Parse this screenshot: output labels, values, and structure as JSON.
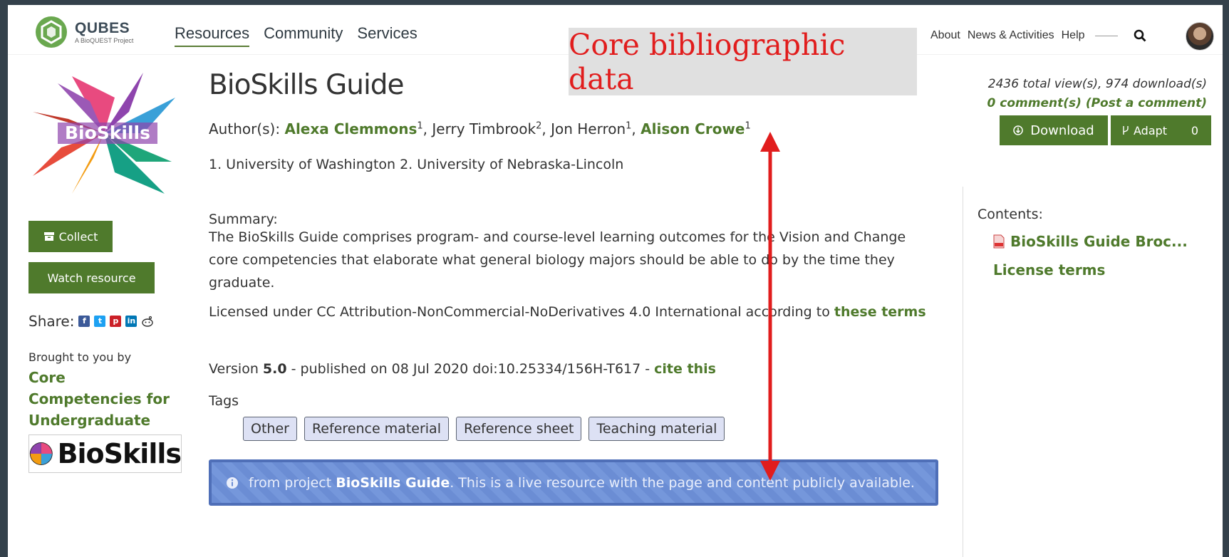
{
  "header": {
    "brand_name": "QUBES",
    "brand_sub": "A BioQUEST Project",
    "nav": [
      "Resources",
      "Community",
      "Services"
    ],
    "right_nav": [
      "About",
      "News & Activities",
      "Help"
    ]
  },
  "annotation": {
    "label": "Core bibliographic data",
    "color": "#e11d1d"
  },
  "resource": {
    "title": "BioSkills Guide",
    "authors_label": "Author(s):",
    "authors": [
      {
        "name": "Alexa Clemmons",
        "sup": "1",
        "linked": true
      },
      {
        "name": "Jerry Timbrook",
        "sup": "2",
        "linked": false
      },
      {
        "name": "Jon Herron",
        "sup": "1",
        "linked": false
      },
      {
        "name": "Alison Crowe",
        "sup": "1",
        "linked": true
      }
    ],
    "affiliations": "1. University of Washington 2. University of Nebraska-Lincoln",
    "summary_label": "Summary:",
    "summary": "The BioSkills Guide comprises program- and course-level learning outcomes for the Vision and Change core competencies that elaborate what general biology majors should be able to do by the time they graduate.",
    "license_text": "Licensed under CC Attribution-NonCommercial-NoDerivatives 4.0 International according to ",
    "license_link": "these terms",
    "version_prefix": "Version ",
    "version": "5.0",
    "version_suffix": " - published on 08 Jul 2020 doi:10.25334/156H-T617 - ",
    "cite_link": "cite this",
    "tags_label": "Tags",
    "tags": [
      "Other",
      "Reference material",
      "Reference sheet",
      "Teaching material"
    ],
    "notice_prefix": "from project ",
    "notice_project": "BioSkills Guide",
    "notice_suffix": ". This is a live resource with the page and content publicly available."
  },
  "sidebar": {
    "collect": "Collect",
    "watch": "Watch resource",
    "share_label": "Share:",
    "brought_label": "Brought to you by",
    "brought_link": "Core Competencies for Undergraduate Biology",
    "banner_text": "BioSkills",
    "logo_text": "BioSkills"
  },
  "stats": {
    "views": "2436 total view(s), 974 download(s)",
    "comments": "0 comment(s) (Post a comment)"
  },
  "actions": {
    "download": "Download",
    "adapt": "Adapt",
    "adapt_count": "0"
  },
  "contents": {
    "label": "Contents:",
    "item": "BioSkills Guide Broc...",
    "license_terms": "License terms"
  },
  "colors": {
    "accent_green": "#4f7a2c",
    "notice_blue": "#6b8dd4",
    "tag_bg": "#dde1f4"
  }
}
